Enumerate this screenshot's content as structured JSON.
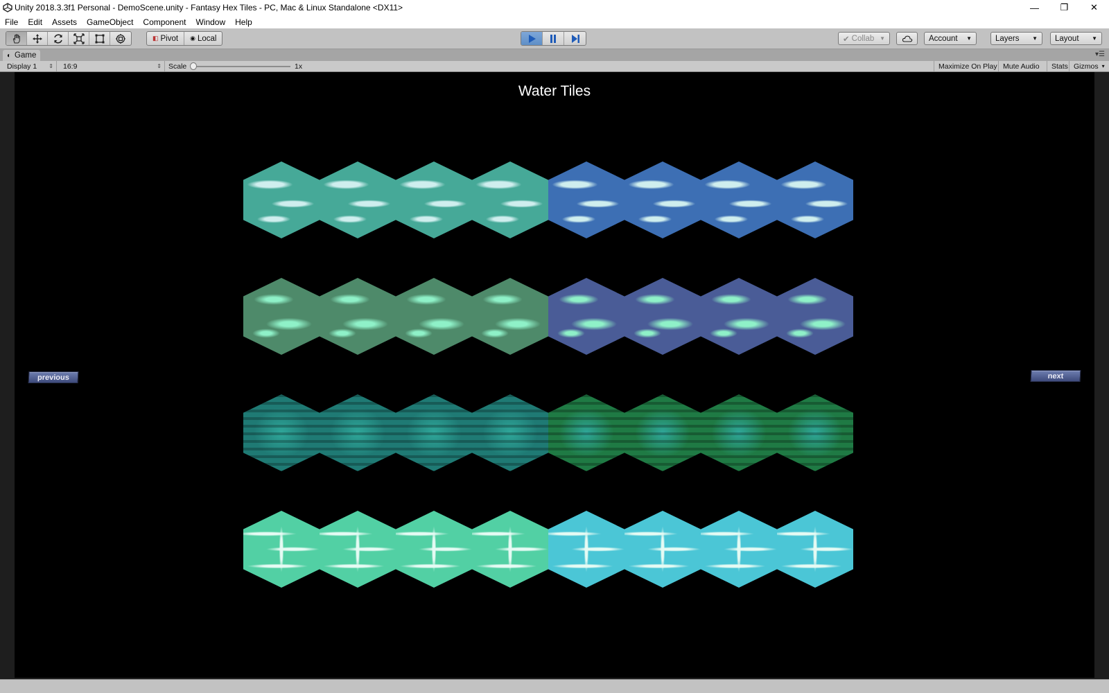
{
  "window": {
    "title": "Unity 2018.3.3f1 Personal - DemoScene.unity - Fantasy Hex Tiles - PC, Mac & Linux Standalone <DX11>",
    "minimize_glyph": "—",
    "restore_glyph": "❐",
    "close_glyph": "✕"
  },
  "menu": {
    "items": [
      "File",
      "Edit",
      "Assets",
      "GameObject",
      "Component",
      "Window",
      "Help"
    ]
  },
  "toolbar": {
    "tools": [
      "hand-icon",
      "move-icon",
      "rotate-icon",
      "scale-icon",
      "rect-icon",
      "transform-icon"
    ],
    "pivot_label": "Pivot",
    "local_label": "Local",
    "collab_label": "Collab",
    "account_label": "Account",
    "layers_label": "Layers",
    "layout_label": "Layout",
    "play_state": "playing"
  },
  "game_tab": {
    "label": "Game"
  },
  "game_controls": {
    "display": "Display 1",
    "aspect": "16:9",
    "scale_label": "Scale",
    "scale_value": "1x",
    "maximize_on_play": "Maximize On Play",
    "mute_audio": "Mute Audio",
    "stats": "Stats",
    "gizmos": "Gizmos"
  },
  "scene": {
    "title": "Water Tiles",
    "previous_label": "previous",
    "next_label": "next",
    "rows": [
      {
        "colors": [
          "#46a998",
          "#46a998",
          "#46a998",
          "#46a998",
          "#3d6fb4",
          "#3d6fb4",
          "#3d6fb4",
          "#3d6fb4"
        ],
        "highlight": "#cfeeee"
      },
      {
        "colors": [
          "#4e8a6a",
          "#4e8a6a",
          "#4e8a6a",
          "#4e8a6a",
          "#4a5c97",
          "#4a5c97",
          "#4a5c97",
          "#4a5c97"
        ],
        "highlight": "#8ff1c8"
      },
      {
        "colors": [
          "#1f7a74",
          "#1f7a74",
          "#1f7a74",
          "#1f7a74",
          "#1f7a44",
          "#1f7a44",
          "#1f7a44",
          "#1f7a44"
        ],
        "highlight": "#2fa79a"
      },
      {
        "colors": [
          "#52d0a4",
          "#52d0a4",
          "#52d0a4",
          "#52d0a4",
          "#4bc6d6",
          "#4bc6d6",
          "#4bc6d6",
          "#4bc6d6"
        ],
        "highlight": "#e6fbf4"
      }
    ]
  }
}
